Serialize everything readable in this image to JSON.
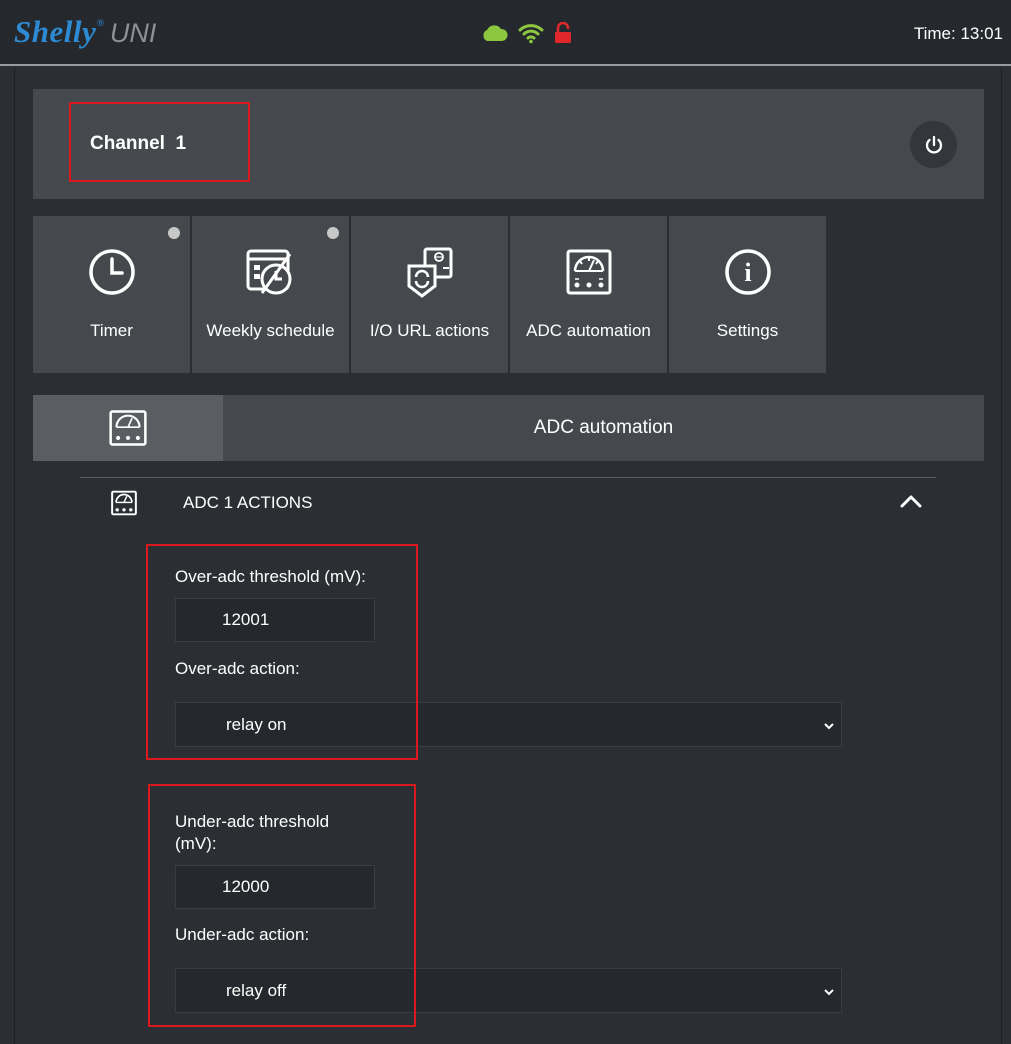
{
  "header": {
    "brand": "Shelly",
    "registered_mark": "®",
    "model": "UNI",
    "time": "Time: 13:01",
    "status_icons": [
      "cloud-icon",
      "wifi-icon",
      "lock-open-icon"
    ],
    "colors": {
      "cloud": "#8dc63f",
      "wifi": "#8dc63f",
      "lock": "#e0282c",
      "brand": "#2d8ad3"
    }
  },
  "channel": {
    "title": "Channel  1"
  },
  "tiles": [
    {
      "label": "Timer",
      "icon": "clock-icon",
      "indicator": true
    },
    {
      "label": "Weekly schedule",
      "icon": "weekly-schedule-icon",
      "indicator": true
    },
    {
      "label": "I/O URL actions",
      "icon": "io-url-actions-icon",
      "indicator": false
    },
    {
      "label": "ADC automation",
      "icon": "adc-gauge-icon",
      "indicator": false
    },
    {
      "label": "Settings",
      "icon": "info-icon",
      "indicator": false
    }
  ],
  "section": {
    "title": "ADC automation",
    "icon": "adc-gauge-icon"
  },
  "adc_actions": {
    "title": "ADC 1 ACTIONS",
    "over_threshold_label": "Over-adc threshold (mV):",
    "over_threshold_value": "12001",
    "over_action_label": "Over-adc action:",
    "over_action_value": "relay on",
    "under_threshold_label": "Under-adc threshold (mV):",
    "under_threshold_value": "12000",
    "under_action_label": "Under-adc action:",
    "under_action_value": "relay off"
  }
}
